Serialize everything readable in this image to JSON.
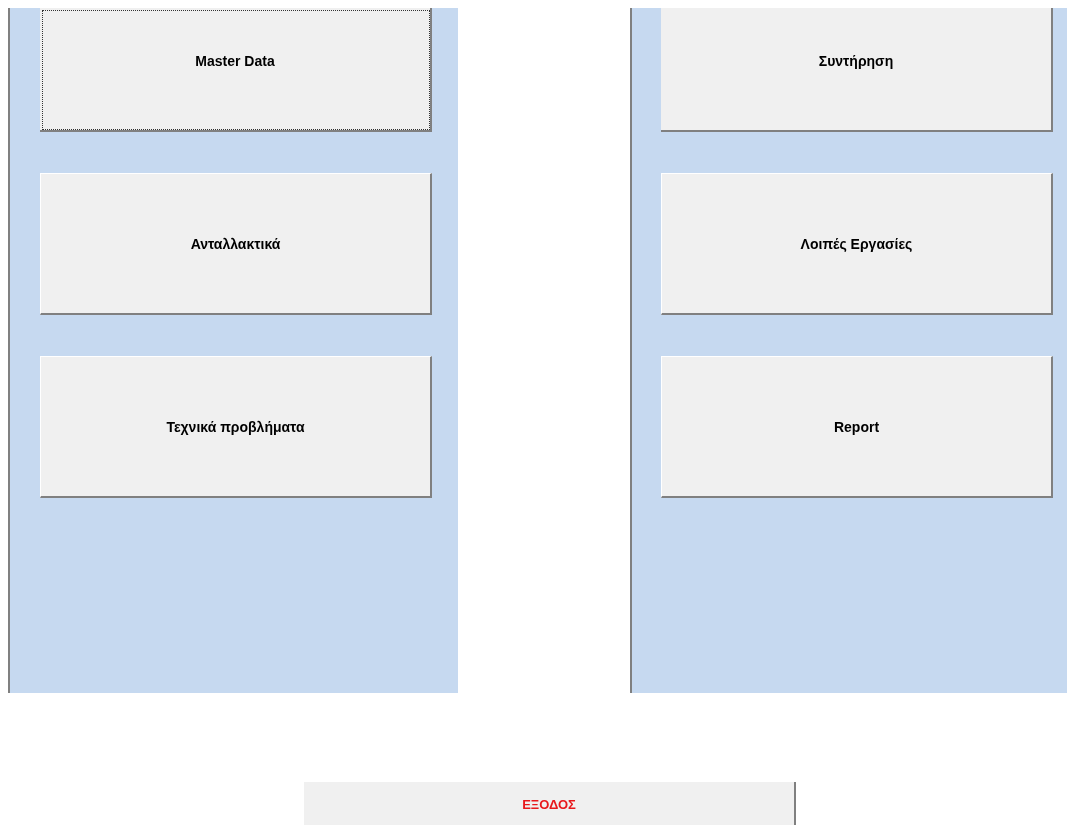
{
  "panels": [
    {
      "buttons": [
        {
          "label": "Master Data",
          "focused": true
        },
        {
          "label": "Ανταλλακτικά",
          "focused": false
        },
        {
          "label": "Τεχνικά προβλήματα",
          "focused": false
        }
      ]
    },
    {
      "buttons": [
        {
          "label": "Συντήρηση",
          "focused": false
        },
        {
          "label": "Λοιπές Εργασίες",
          "focused": false
        },
        {
          "label": "Report",
          "focused": false
        }
      ]
    }
  ],
  "exit_button": {
    "label": "ΕΞΟΔΟΣ"
  }
}
